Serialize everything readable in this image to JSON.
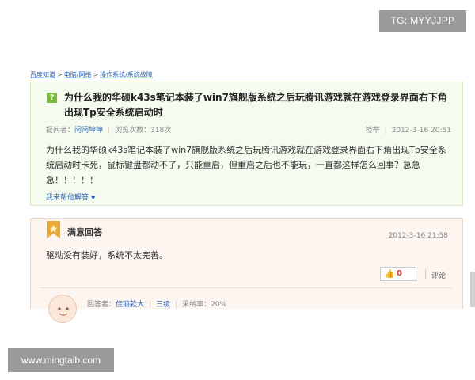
{
  "watermarks": {
    "top": "TG: MYYJJPP",
    "bottom": "www.mingtaib.com"
  },
  "breadcrumb": [
    "百度知道",
    "电脑/网络",
    "操作系统/系统故障"
  ],
  "question": {
    "icon": "?",
    "title": "为什么我的华硕k43s笔记本装了win7旗舰版系统之后玩腾讯游戏就在游戏登录界面右下角出现Tp安全系统启动时",
    "asker_label": "提问者：",
    "asker_name": "闲闲坤坤",
    "views": "浏览次数：318次",
    "report": "检举",
    "time": "2012-3-16 20:51",
    "body": "为什么我的华硕k43s笔记本装了win7旗舰版系统之后玩腾讯游戏就在游戏登录界面右下角出现Tp安全系统启动时卡死，鼠标键盘都动不了，只能重启，但重启之后也不能玩，一直都这样怎么回事？急急急！！！！！",
    "help_link": "我来帮他解答"
  },
  "answer": {
    "title": "满意回答",
    "time": "2012-3-16 21:58",
    "body": "驱动没有装好，系统不太完善。",
    "likes": "0",
    "comment": "评论",
    "answerer_label": "回答者：",
    "answerer_name": "佳丽款大",
    "level": "三级",
    "rate": "采纳率：20%"
  },
  "colors": {
    "link": "#2d64b3",
    "question_bg": "#f5fbef",
    "answer_bg": "#fdf5f0",
    "question_icon": "#79b93b",
    "badge": "#e8a83a"
  }
}
